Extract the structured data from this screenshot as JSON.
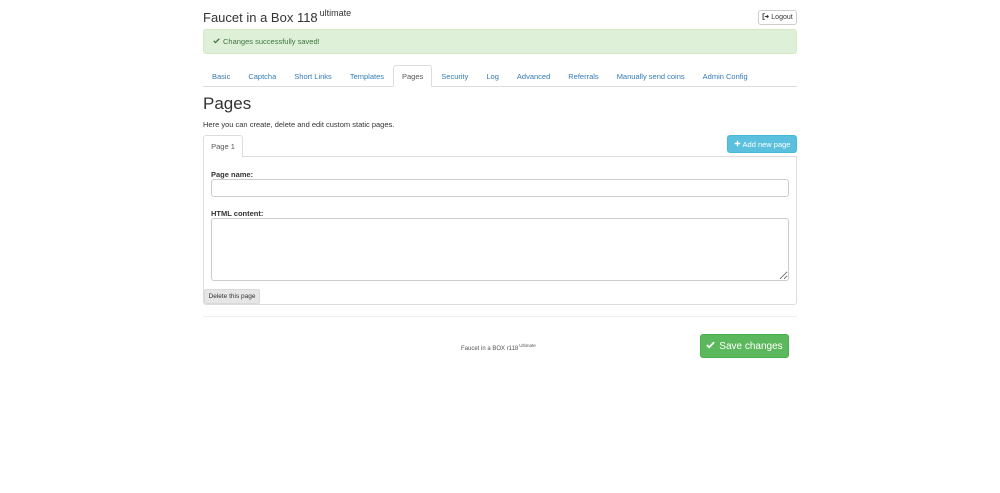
{
  "header": {
    "app_title": "Faucet in a Box 118",
    "app_edition": "ultimate",
    "logout_label": "Logout"
  },
  "alert": {
    "message": "Changes successfully saved!"
  },
  "tabs": [
    {
      "label": "Basic",
      "active": false
    },
    {
      "label": "Captcha",
      "active": false
    },
    {
      "label": "Short Links",
      "active": false
    },
    {
      "label": "Templates",
      "active": false
    },
    {
      "label": "Pages",
      "active": true
    },
    {
      "label": "Security",
      "active": false
    },
    {
      "label": "Log",
      "active": false
    },
    {
      "label": "Advanced",
      "active": false
    },
    {
      "label": "Referrals",
      "active": false
    },
    {
      "label": "Manually send coins",
      "active": false
    },
    {
      "label": "Admin Config",
      "active": false
    }
  ],
  "pages_section": {
    "heading": "Pages",
    "description": "Here you can create, delete and edit custom static pages.",
    "add_page_label": "Add new page",
    "page_tab_label": "Page 1",
    "page_name_label": "Page name:",
    "page_name_value": "",
    "html_content_label": "HTML content:",
    "html_content_value": "",
    "delete_label": "Delete this page"
  },
  "footer": {
    "text": "Faucet in a BOX r118",
    "edition": "Ultimate",
    "save_label": "Save changes"
  },
  "colors": {
    "alert_bg": "#dff0d8",
    "alert_text": "#3c763d",
    "link": "#337ab7",
    "info_button": "#5bc0de",
    "success_button": "#5cb85c"
  },
  "icons": {
    "logout": "sign-out-icon",
    "alert": "check-icon",
    "add": "plus-icon",
    "save": "check-icon"
  }
}
